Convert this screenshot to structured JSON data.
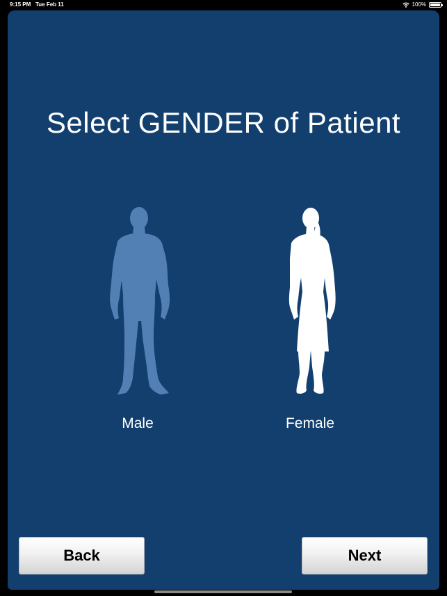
{
  "status_bar": {
    "time": "9:15 PM",
    "date": "Tue Feb 11",
    "battery": "100%",
    "battery_level": 1.0,
    "wifi_icon": "wifi-icon",
    "battery_icon": "battery-icon"
  },
  "screen": {
    "title": "Select GENDER of Patient",
    "background_color": "#123f6e"
  },
  "genders": {
    "male": {
      "label": "Male",
      "icon": "male-silhouette-icon",
      "color": "#5280b5",
      "selected": false
    },
    "female": {
      "label": "Female",
      "icon": "female-silhouette-icon",
      "color": "#ffffff",
      "selected": true
    }
  },
  "buttons": {
    "back_label": "Back",
    "next_label": "Next"
  }
}
